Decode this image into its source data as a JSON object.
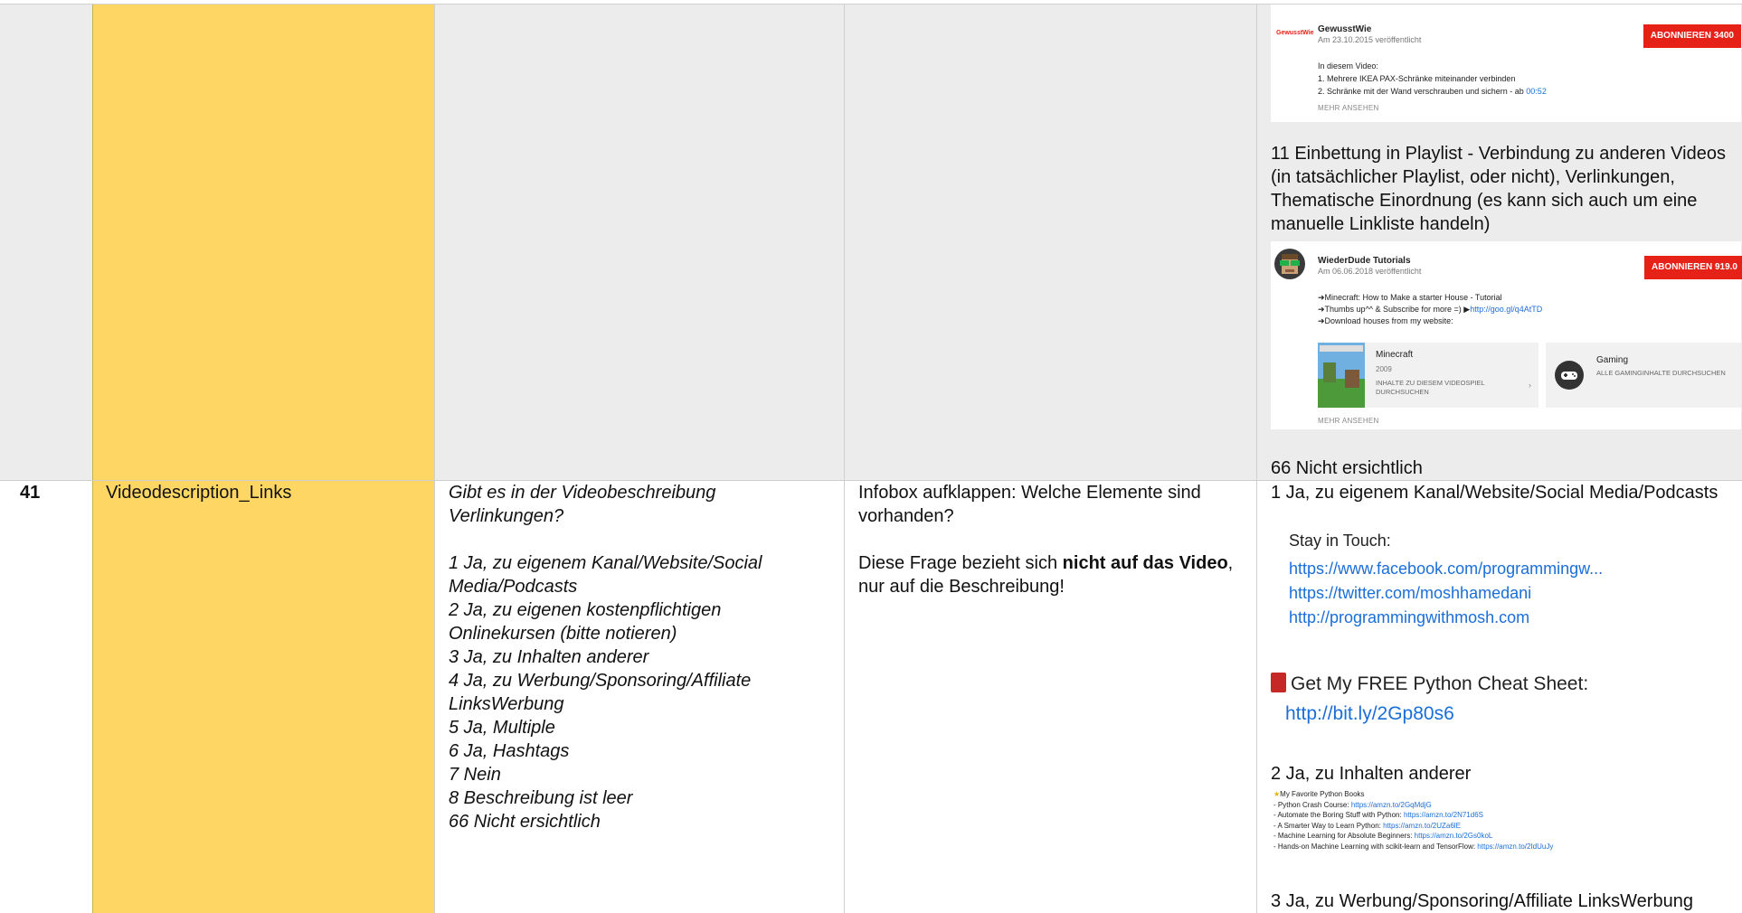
{
  "row_top": {
    "card1": {
      "logo_text": "GewusstWie",
      "channel": "GewusstWie",
      "date": "Am 23.10.2015 veröffentlicht",
      "subscribe": "ABONNIEREN  3400",
      "lines": [
        "In diesem Video:",
        "1. Mehrere IKEA PAX-Schränke miteinander verbinden",
        "2. Schränke mit der Wand verschrauben und sichern - ab "
      ],
      "timestamp": "00:52",
      "more": "MEHR ANSEHEN"
    },
    "option11": "11 Einbettung in Playlist - Verbindung zu anderen Videos (in tatsächlicher Playlist, oder nicht), Verlinkungen, Thematische Einordnung (es kann sich auch um eine manuelle Linkliste handeln)",
    "card2": {
      "channel": "WiederDude Tutorials",
      "date": "Am 06.06.2018 veröffentlicht",
      "subscribe": "ABONNIEREN  919.0",
      "lines": [
        "➜Minecraft: How to Make a starter House  - Tutorial",
        "➜Thumbs up^^ & Subscribe for more =) ▶",
        "➜Download houses from my website:"
      ],
      "link": "http://goo.gl/q4AtTD",
      "game_title": "Minecraft",
      "game_year": "2009",
      "game_action": "INHALTE ZU DIESEM VIDEOSPIEL DURCHSUCHEN",
      "gaming_title": "Gaming",
      "gaming_action": "ALLE GAMINGINHALTE DURCHSUCHEN",
      "more": "MEHR ANSEHEN"
    },
    "option66": "66 Nicht ersichtlich"
  },
  "row41": {
    "number": "41",
    "variable": "Videodescription_Links",
    "question": "Gibt es in der Videobeschreibung Verlinkungen?",
    "options": [
      "1 Ja, zu eigenem Kanal/Website/Social Media/Podcasts",
      "2 Ja, zu eigenen kostenpflichtigen Onlinekursen (bitte notieren)",
      "3 Ja, zu Inhalten anderer",
      "4 Ja, zu Werbung/Sponsoring/Affiliate LinksWerbung",
      "5 Ja, Multiple",
      "6 Ja, Hashtags",
      "7 Nein",
      "8  Beschreibung ist leer",
      "66 Nicht ersichtlich"
    ],
    "instruction": "Infobox aufklappen: Welche Elemente sind vorhanden?",
    "note_pre": "Diese Frage bezieht sich ",
    "note_bold": "nicht auf das Video",
    "note_post": ", nur auf die Beschreibung!",
    "example1_label": "1 Ja, zu eigenem Kanal/Website/Social Media/Podcasts",
    "stay": "Stay in Touch:",
    "links": [
      "https://www.facebook.com/programmingw...",
      "https://twitter.com/moshhamedani",
      "http://programmingwithmosh.com"
    ],
    "cheat": "Get My FREE Python Cheat Sheet:",
    "cheat_link": "http://bit.ly/2Gp80s6",
    "example2_label": "2 Ja, zu Inhalten anderer",
    "books_title": "My Favorite Python Books",
    "books": [
      {
        "t": "- Python Crash Course: ",
        "l": "https://amzn.to/2GqMdjG"
      },
      {
        "t": "- Automate the Boring Stuff with Python: ",
        "l": "https://amzn.to/2N71d6S"
      },
      {
        "t": "- A Smarter Way to Learn Python: ",
        "l": "https://amzn.to/2UZa6lE"
      },
      {
        "t": "- Machine Learning for Absolute Beginners: ",
        "l": "https://amzn.to/2Gs0koL"
      },
      {
        "t": "- Hands-on Machine Learning with scikit-learn and TensorFlow: ",
        "l": "https://amzn.to/2IdUuJy"
      }
    ],
    "example3_label": "3 Ja, zu Werbung/Sponsoring/Affiliate LinksWerbung"
  }
}
